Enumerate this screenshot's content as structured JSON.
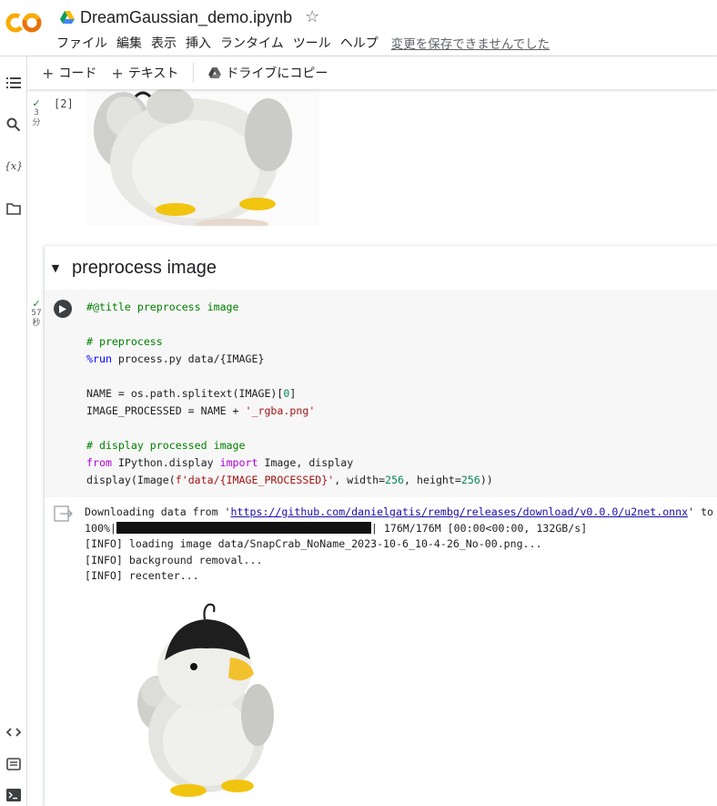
{
  "header": {
    "logo_icon": "colab-logo-icon",
    "drive_icon": "google-drive-icon",
    "title": "DreamGaussian_demo.ipynb",
    "star_glyph": "☆",
    "menu": [
      "ファイル",
      "編集",
      "表示",
      "挿入",
      "ランタイム",
      "ツール",
      "ヘルプ"
    ],
    "save_warning": "変更を保存できませんでした"
  },
  "toolbar": {
    "plus_glyph": "+",
    "add_code": "コード",
    "add_text": "テキスト",
    "copy_to_drive": "ドライブにコピー"
  },
  "sidebar": {
    "icons": [
      "toc-icon",
      "search-icon",
      "variables-icon",
      "files-icon",
      "code-snippets-icon",
      "command-palette-icon",
      "terminal-icon"
    ]
  },
  "prev_cell": {
    "check": "✓",
    "time_value": "3",
    "time_unit": "分",
    "exec_count": "[2]"
  },
  "section": {
    "collapse_glyph": "▼",
    "title": "preprocess image",
    "cell": {
      "check": "✓",
      "time_value": "57",
      "time_unit": "秒",
      "code": {
        "title_line": "#@title preprocess image",
        "comment1": "# preprocess",
        "run_magic": "%run",
        "run_rest": " process.py data/{IMAGE}",
        "name_pre": "NAME = os.path.splitext(IMAGE)[",
        "name_idx": "0",
        "name_post": "]",
        "proc_pre": "IMAGE_PROCESSED = NAME + ",
        "proc_str": "'_rgba.png'",
        "comment2": "# display processed image",
        "from_kw": "from",
        "import_mid": " IPython.display ",
        "import_kw": "import",
        "import_rest": " Image, display",
        "disp_pre": "display(Image(",
        "disp_str": "f'data/{IMAGE_PROCESSED}'",
        "disp_mid1": ", width=",
        "disp_w": "256",
        "disp_mid2": ", height=",
        "disp_h": "256",
        "disp_post": "))"
      },
      "output": {
        "dl_pre": "Downloading data from '",
        "dl_link": "https://github.com/danielgatis/rembg/releases/download/v0.0.0/u2net.onnx",
        "dl_post": "' to",
        "progress_pre": "100%|",
        "progress_post": "| 176M/176M [00:00<00:00, 132GB/s]",
        "log1": "[INFO] loading image data/SnapCrab_NoName_2023-10-6_10-4-26_No-00.png...",
        "log2": "[INFO] background removal...",
        "log3": "[INFO] recenter..."
      }
    }
  },
  "colors": {
    "accent_green": "#188038",
    "code_bg": "#f7f7f7",
    "link": "#1a0dab"
  }
}
